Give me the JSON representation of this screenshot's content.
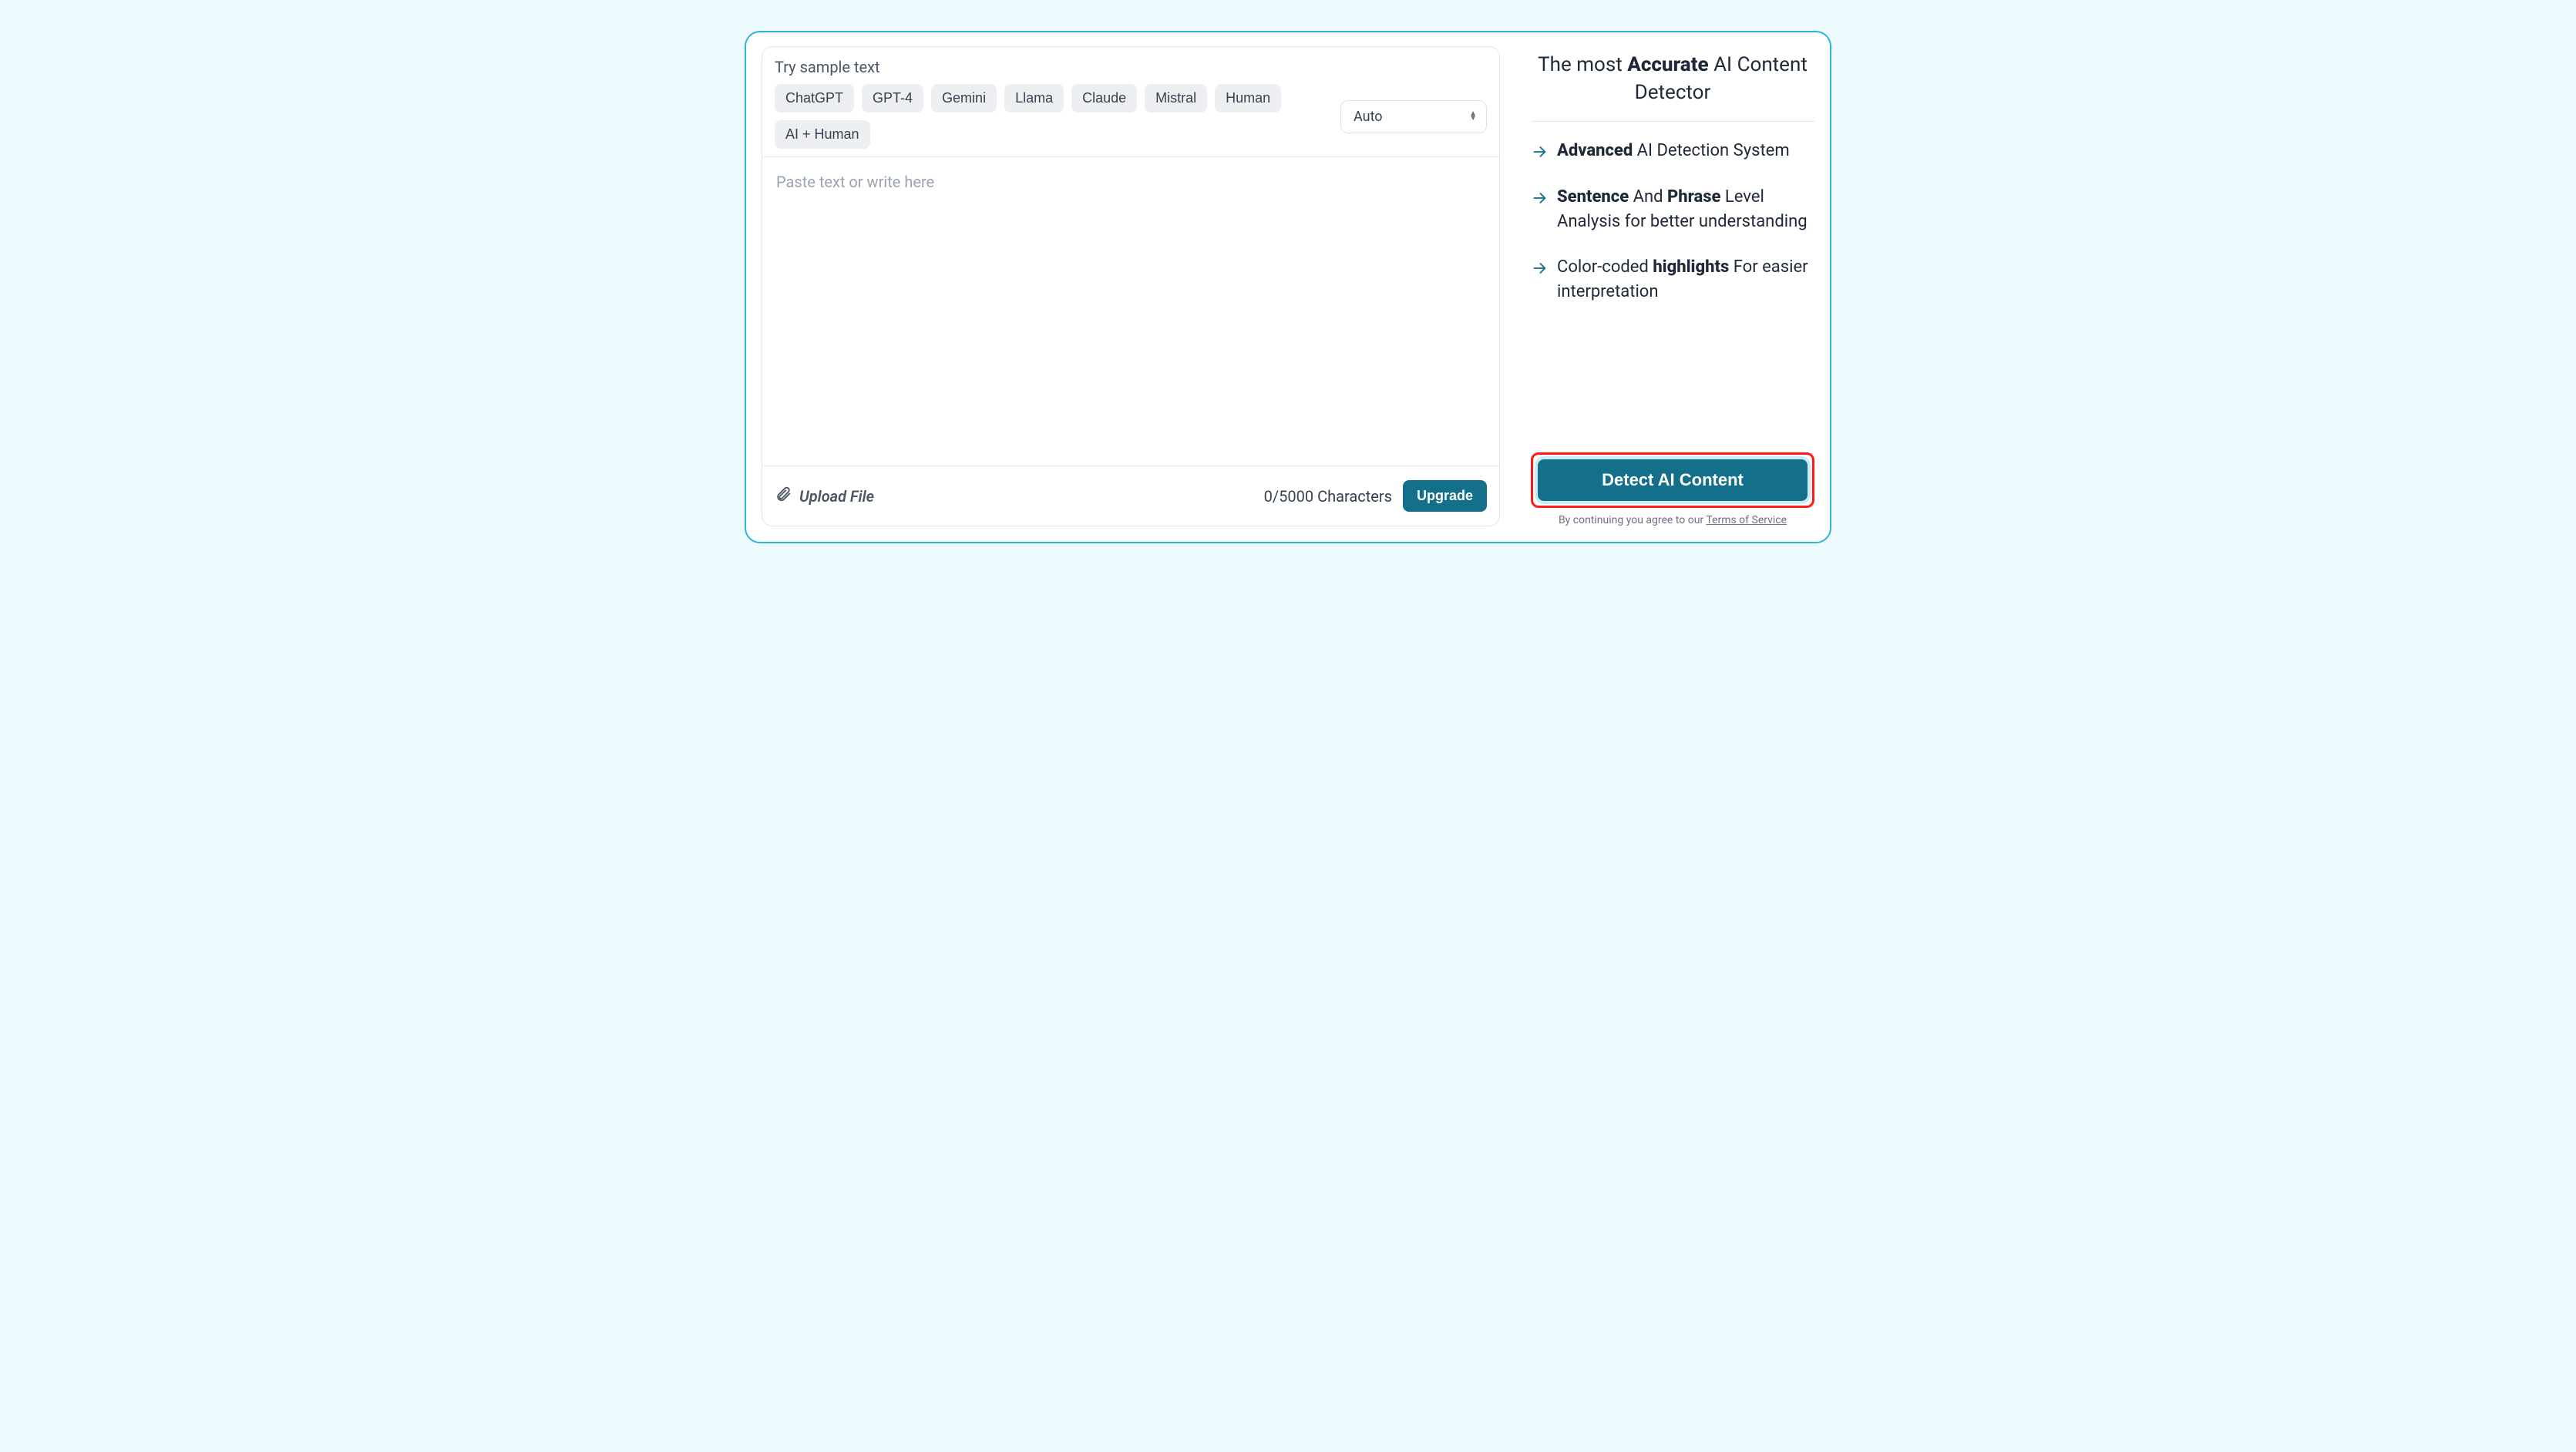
{
  "samples": {
    "title": "Try sample text",
    "chips": [
      "ChatGPT",
      "GPT-4",
      "Gemini",
      "Llama",
      "Claude",
      "Mistral",
      "Human",
      "AI + Human"
    ]
  },
  "langSelect": {
    "value": "Auto"
  },
  "textarea": {
    "placeholder": "Paste text or write here",
    "value": ""
  },
  "bottom": {
    "uploadLabel": "Upload File",
    "counter": "0/5000 Characters",
    "upgrade": "Upgrade"
  },
  "headline": {
    "pre": "The most ",
    "bold": "Accurate",
    "post": " AI Content Detector"
  },
  "features": [
    {
      "b1": "Advanced",
      "t1": " AI Detection System"
    },
    {
      "b1": "Sentence",
      "t1": " And ",
      "b2": "Phrase",
      "t2": " Level Analysis for better understanding"
    },
    {
      "t0": "Color-coded ",
      "b1": "highlights",
      "t1": " For easier interpretation"
    }
  ],
  "cta": "Detect AI Content",
  "tos": {
    "pre": "By continuing you agree to our ",
    "link": "Terms of Service"
  }
}
